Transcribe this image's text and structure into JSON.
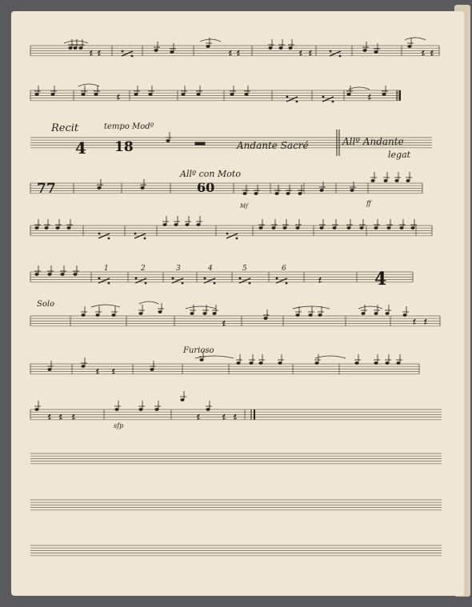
{
  "page": {
    "paper_color": "#efe6d6",
    "edge_color": "#d8ccb7",
    "ink_color": "#2a2118",
    "staff_line_color": "#6f665a",
    "background_color": "#5a5a5c"
  },
  "markings": {
    "recit": "Recit",
    "tempo_mo": "tempo Modº",
    "andante": "Andante Sacré",
    "allegro_andante": "Allº Andante",
    "legato": "legat",
    "allo_con_moto": "Allº con Moto",
    "furioso": "Furioso",
    "solo": "Solo",
    "rest_4_a": "4",
    "rest_18": "18",
    "rest_77": "77",
    "rest_60": "60",
    "rest_4_b": "4",
    "mf": "Mf",
    "ff": "ff",
    "p": "p",
    "sfp": "sfp"
  },
  "repeat_numbers": [
    "1",
    "2",
    "3",
    "4",
    "5",
    "6"
  ]
}
